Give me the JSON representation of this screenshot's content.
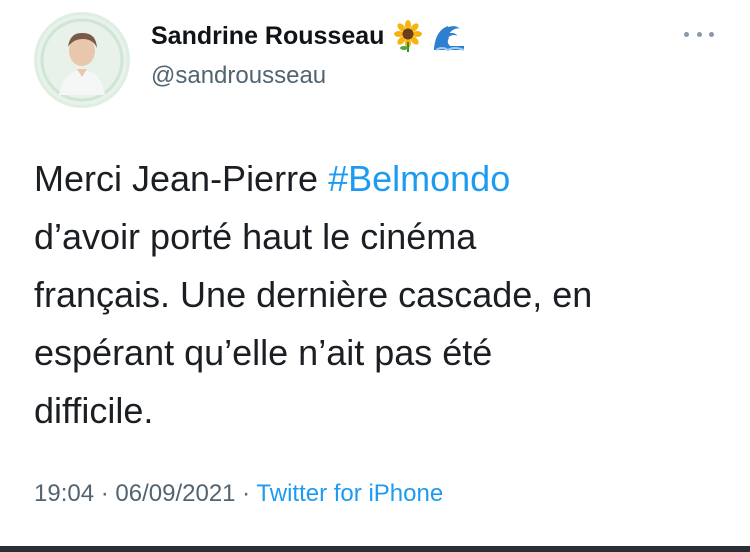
{
  "author": {
    "display_name": "Sandrine Rousseau",
    "handle": "@sandrousseau",
    "name_emojis": [
      "sunflower-emoji",
      "wave-emoji"
    ]
  },
  "tweet": {
    "line1_text": "Merci Jean-Pierre ",
    "line1_hashtag": "#Belmondo",
    "line2": "d’avoir porté haut le cinéma",
    "line3": "français. Une dernière cascade, en",
    "line4": "espérant qu’elle n’ait pas été",
    "line5": "difficile."
  },
  "meta": {
    "time": "19:04",
    "separator": " · ",
    "date": "06/09/2021",
    "source": "Twitter for iPhone"
  },
  "colors": {
    "hashtag": "#1d9bf0",
    "secondary_text": "#536471"
  }
}
